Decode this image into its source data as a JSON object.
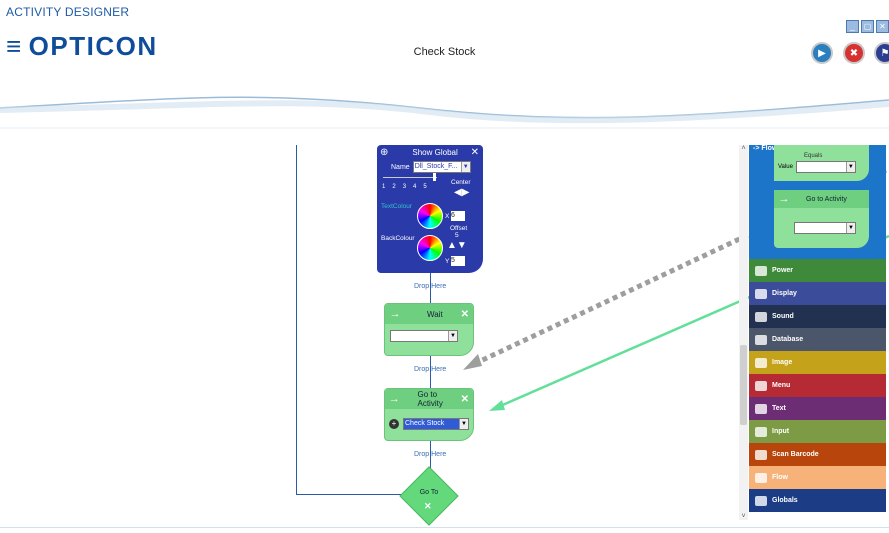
{
  "app": {
    "title": "ACTIVITY DESIGNER",
    "logo": "OPTICON",
    "page_title": "Check Stock"
  },
  "window_controls": [
    "_",
    "▢",
    "✕"
  ],
  "toolbar": {
    "play": "▶",
    "stop": "✖",
    "language": "⚑"
  },
  "canvas": {
    "show_global": {
      "title": "Show Global",
      "name_label": "Name",
      "name_value": "Dll_Stock_F...",
      "scale": [
        "1",
        "2",
        "3",
        "4",
        "5"
      ],
      "center_label": "Center",
      "text_colour_label": "TextColour",
      "back_colour_label": "BackColour",
      "offset_label": "Offset",
      "offset_value": "5",
      "x_label": "X",
      "x_value": "6",
      "y_label": "Y",
      "y_value": "5"
    },
    "drop_here_1": "Drop Here",
    "wait": {
      "title": "Wait",
      "value": ""
    },
    "drop_here_2": "Drop Here",
    "go_to_activity": {
      "title": "Go to Activity",
      "value": "Check Stock"
    },
    "drop_here_3": "Drop Here",
    "go_to": {
      "label": "Go To"
    }
  },
  "palette": {
    "header": "-> Flow",
    "preview": {
      "equals_label": "Equals",
      "value_label": "Value",
      "block_title": "Go to Activity"
    },
    "categories": [
      {
        "label": "Power",
        "color": "#3f8a3a"
      },
      {
        "label": "Display",
        "color": "#3b4d9a"
      },
      {
        "label": "Sound",
        "color": "#22314f"
      },
      {
        "label": "Database",
        "color": "#4c566a"
      },
      {
        "label": "Image",
        "color": "#c4a21a"
      },
      {
        "label": "Menu",
        "color": "#b52a33"
      },
      {
        "label": "Text",
        "color": "#6d2d74"
      },
      {
        "label": "Input",
        "color": "#7d9a45"
      },
      {
        "label": "Scan Barcode",
        "color": "#b8460c"
      },
      {
        "label": "Flow",
        "color": "#f7b27a"
      },
      {
        "label": "Globals",
        "color": "#1c3c86"
      }
    ]
  }
}
